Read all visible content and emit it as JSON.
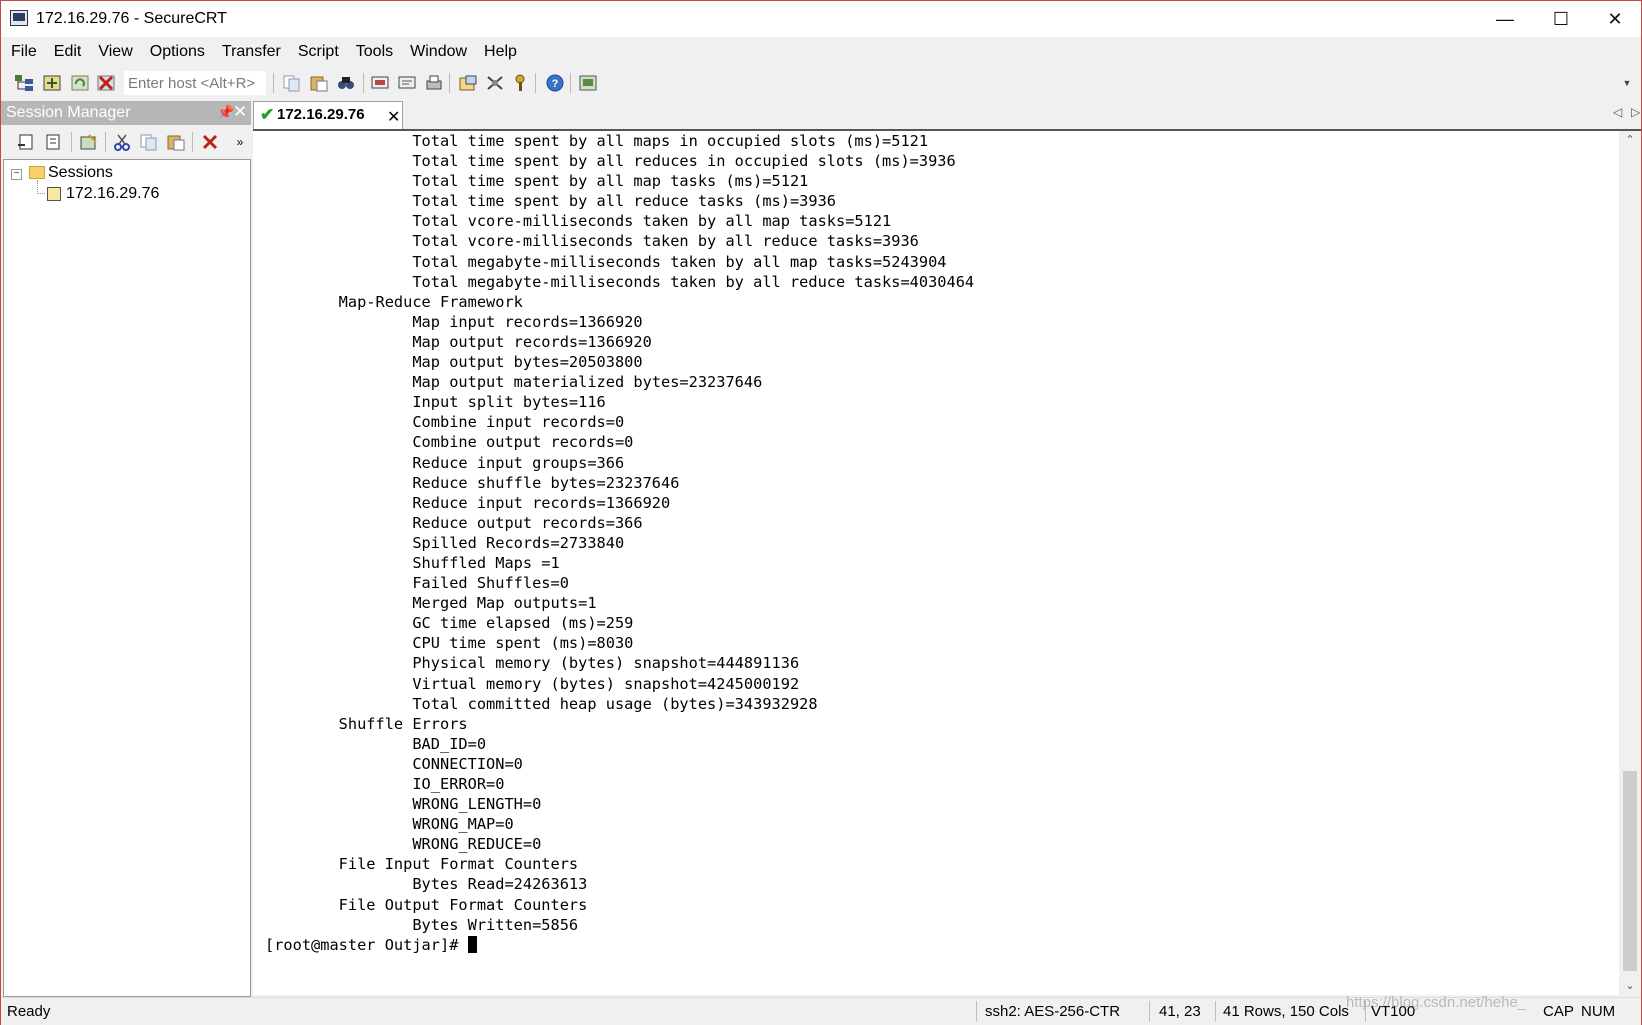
{
  "window": {
    "title": "172.16.29.76 - SecureCRT"
  },
  "menu": [
    "File",
    "Edit",
    "View",
    "Options",
    "Transfer",
    "Script",
    "Tools",
    "Window",
    "Help"
  ],
  "toolbar": {
    "host_placeholder": "Enter host <Alt+R>"
  },
  "session_manager": {
    "title": "Session Manager",
    "tree": {
      "root": "Sessions",
      "session": "172.16.29.76"
    }
  },
  "tab": {
    "label": "172.16.29.76"
  },
  "terminal": {
    "lines": [
      "\t\tTotal time spent by all maps in occupied slots (ms)=5121",
      "\t\tTotal time spent by all reduces in occupied slots (ms)=3936",
      "\t\tTotal time spent by all map tasks (ms)=5121",
      "\t\tTotal time spent by all reduce tasks (ms)=3936",
      "\t\tTotal vcore-milliseconds taken by all map tasks=5121",
      "\t\tTotal vcore-milliseconds taken by all reduce tasks=3936",
      "\t\tTotal megabyte-milliseconds taken by all map tasks=5243904",
      "\t\tTotal megabyte-milliseconds taken by all reduce tasks=4030464",
      "\tMap-Reduce Framework",
      "\t\tMap input records=1366920",
      "\t\tMap output records=1366920",
      "\t\tMap output bytes=20503800",
      "\t\tMap output materialized bytes=23237646",
      "\t\tInput split bytes=116",
      "\t\tCombine input records=0",
      "\t\tCombine output records=0",
      "\t\tReduce input groups=366",
      "\t\tReduce shuffle bytes=23237646",
      "\t\tReduce input records=1366920",
      "\t\tReduce output records=366",
      "\t\tSpilled Records=2733840",
      "\t\tShuffled Maps =1",
      "\t\tFailed Shuffles=0",
      "\t\tMerged Map outputs=1",
      "\t\tGC time elapsed (ms)=259",
      "\t\tCPU time spent (ms)=8030",
      "\t\tPhysical memory (bytes) snapshot=444891136",
      "\t\tVirtual memory (bytes) snapshot=4245000192",
      "\t\tTotal committed heap usage (bytes)=343932928",
      "\tShuffle Errors",
      "\t\tBAD_ID=0",
      "\t\tCONNECTION=0",
      "\t\tIO_ERROR=0",
      "\t\tWRONG_LENGTH=0",
      "\t\tWRONG_MAP=0",
      "\t\tWRONG_REDUCE=0",
      "\tFile Input Format Counters ",
      "\t\tBytes Read=24263613",
      "\tFile Output Format Counters ",
      "\t\tBytes Written=5856"
    ],
    "prompt": "[root@master Outjar]# "
  },
  "status": {
    "ready": "Ready",
    "cipher": "ssh2: AES-256-CTR",
    "position": "41,  23",
    "size": "41 Rows, 150 Cols",
    "emulation": "VT100",
    "caps": "CAP",
    "num": "NUM",
    "watermark": "https://blog.csdn.net/hehe_"
  }
}
